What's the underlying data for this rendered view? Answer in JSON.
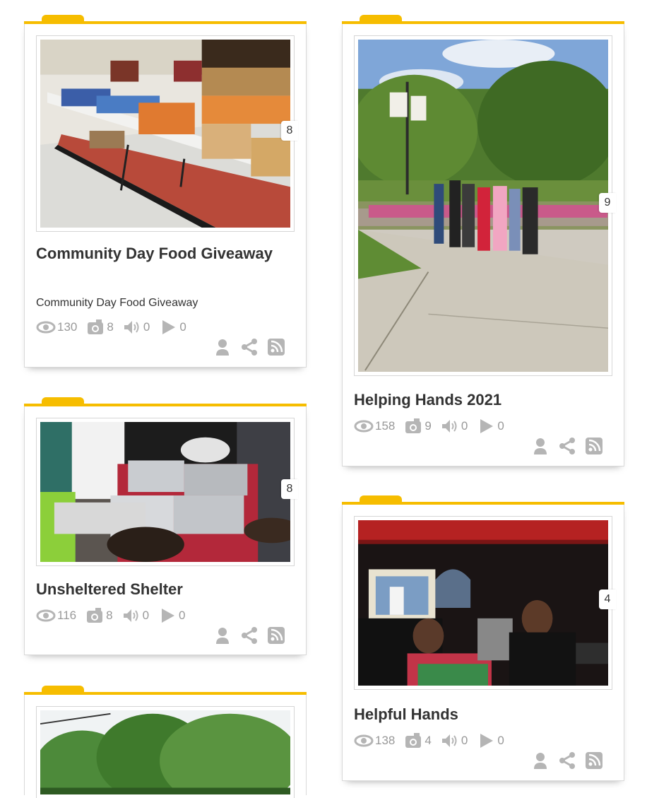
{
  "cards": [
    {
      "title": "Community Day Food Giveaway",
      "subtitle": "Community Day Food Giveaway",
      "photo_count": "8",
      "stats": {
        "views": "130",
        "photos": "8",
        "audio": "0",
        "videos": "0"
      }
    },
    {
      "title": "Helping Hands 2021",
      "photo_count": "9",
      "stats": {
        "views": "158",
        "photos": "9",
        "audio": "0",
        "videos": "0"
      }
    },
    {
      "title": "Unsheltered Shelter",
      "photo_count": "8",
      "stats": {
        "views": "116",
        "photos": "8",
        "audio": "0",
        "videos": "0"
      }
    },
    {
      "title": "Helpful Hands",
      "photo_count": "4",
      "stats": {
        "views": "138",
        "photos": "4",
        "audio": "0",
        "videos": "0"
      }
    }
  ],
  "icons": [
    "eye-icon",
    "camera-icon",
    "audio-icon",
    "play-icon",
    "user-icon",
    "share-icon",
    "rss-icon"
  ],
  "colors": {
    "accent": "#f6bd00",
    "icon": "#b5b5b5",
    "title": "#333333"
  }
}
